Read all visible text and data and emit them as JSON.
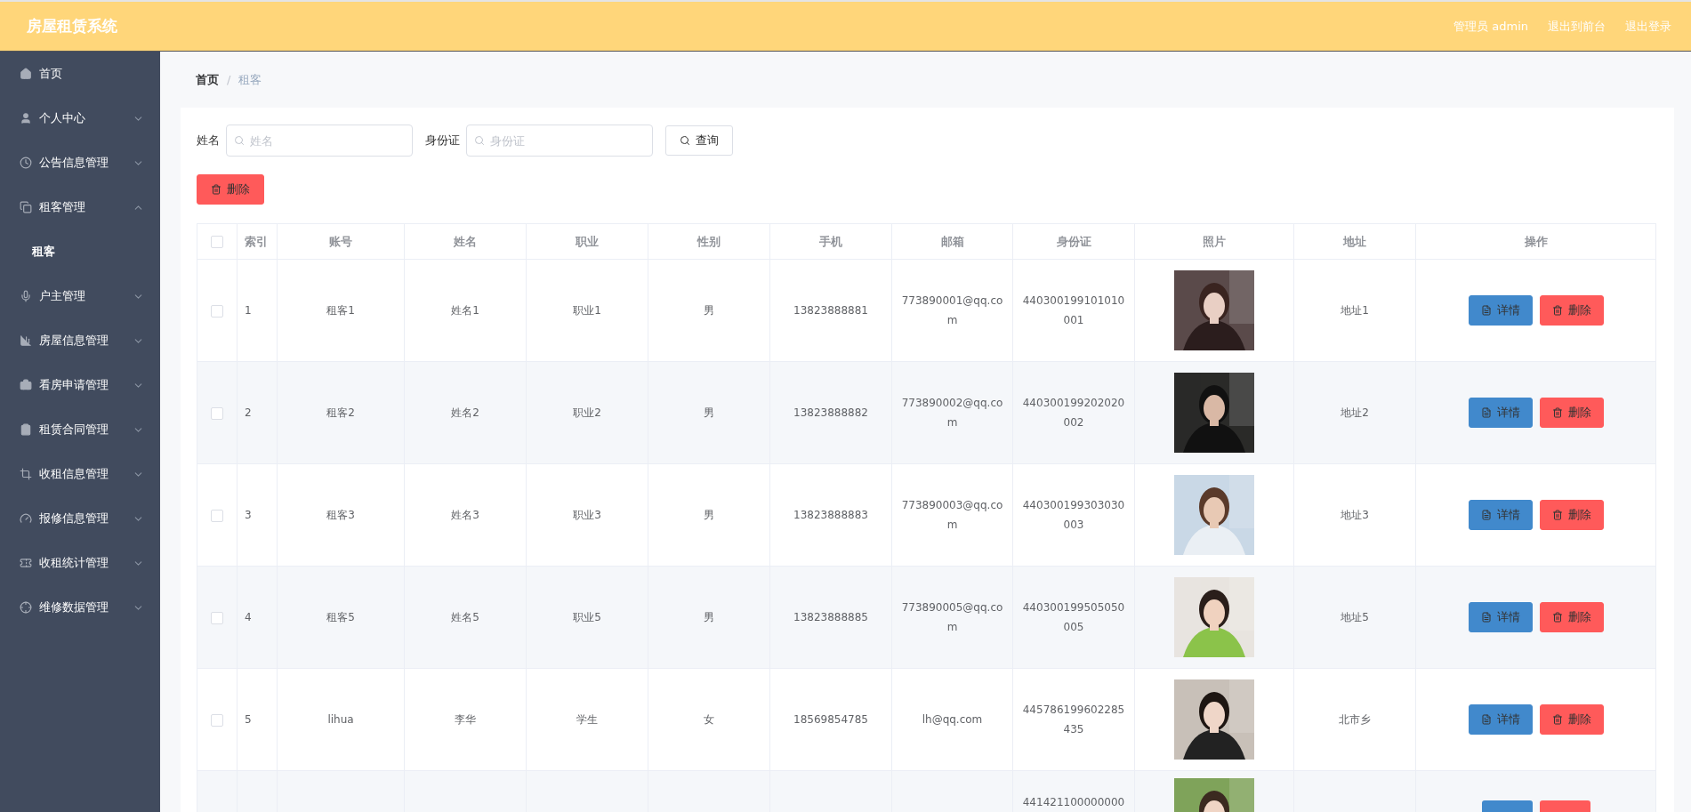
{
  "header": {
    "title": "房屋租赁系统",
    "user": "管理员 admin",
    "links": [
      "退出到前台",
      "退出登录"
    ]
  },
  "sidebar": {
    "items": [
      {
        "label": "首页"
      },
      {
        "label": "个人中心",
        "expanded": false
      },
      {
        "label": "公告信息管理",
        "expanded": false
      },
      {
        "label": "租客管理",
        "expanded": true,
        "children": [
          {
            "label": "租客",
            "selected": true
          }
        ]
      },
      {
        "label": "户主管理",
        "expanded": false
      },
      {
        "label": "房屋信息管理",
        "expanded": false
      },
      {
        "label": "看房申请管理",
        "expanded": false
      },
      {
        "label": "租赁合同管理",
        "expanded": false
      },
      {
        "label": "收租信息管理",
        "expanded": false
      },
      {
        "label": "报修信息管理",
        "expanded": false
      },
      {
        "label": "收租统计管理",
        "expanded": false
      },
      {
        "label": "维修数据管理",
        "expanded": false
      }
    ]
  },
  "breadcrumb": [
    "首页",
    "租客"
  ],
  "breadcrumb_separator": "/",
  "search": {
    "fields": [
      {
        "label": "姓名",
        "placeholder": "姓名"
      },
      {
        "label": "身份证",
        "placeholder": "身份证"
      }
    ],
    "button": "查询"
  },
  "bulk_delete": "删除",
  "table": {
    "select_all": {
      "checked": false
    },
    "columns": [
      "索引",
      "账号",
      "姓名",
      "职业",
      "性别",
      "手机",
      "邮箱",
      "身份证",
      "照片",
      "地址",
      "操作"
    ],
    "rows": [
      {
        "checked": false,
        "index": "1",
        "account": "租客1",
        "name": "姓名1",
        "job": "职业1",
        "gender": "男",
        "phone": "13823888881",
        "email": "773890001@qq.com",
        "id_number": "440300199101010001",
        "address": "地址1",
        "actions": [
          "详情",
          "删除"
        ]
      },
      {
        "checked": false,
        "index": "2",
        "account": "租客2",
        "name": "姓名2",
        "job": "职业2",
        "gender": "男",
        "phone": "13823888882",
        "email": "773890002@qq.com",
        "id_number": "440300199202020002",
        "address": "地址2",
        "actions": [
          "详情",
          "删除"
        ]
      },
      {
        "checked": false,
        "index": "3",
        "account": "租客3",
        "name": "姓名3",
        "job": "职业3",
        "gender": "男",
        "phone": "13823888883",
        "email": "773890003@qq.com",
        "id_number": "440300199303030003",
        "address": "地址3",
        "actions": [
          "详情",
          "删除"
        ]
      },
      {
        "checked": false,
        "index": "4",
        "account": "租客5",
        "name": "姓名5",
        "job": "职业5",
        "gender": "男",
        "phone": "13823888885",
        "email": "773890005@qq.com",
        "id_number": "440300199505050005",
        "address": "地址5",
        "actions": [
          "详情",
          "删除"
        ]
      },
      {
        "checked": false,
        "index": "5",
        "account": "lihua",
        "name": "李华",
        "job": "学生",
        "gender": "女",
        "phone": "18569854785",
        "email": "lh@qq.com",
        "id_number": "445786199602285435",
        "address": "北市乡",
        "actions": [
          "详情",
          "删除"
        ]
      }
    ],
    "cut_row": {
      "id_number": "441421100000000"
    }
  }
}
